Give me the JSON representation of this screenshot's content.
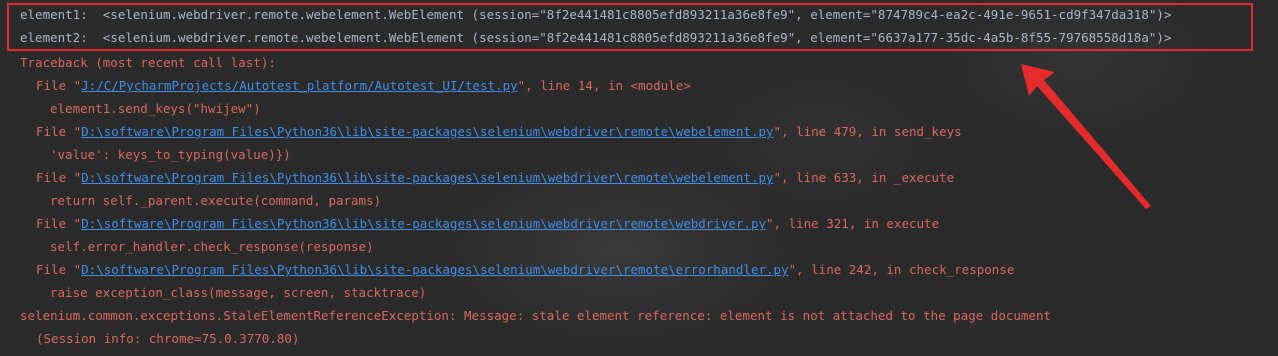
{
  "output": {
    "element1_line": "element1:  <selenium.webdriver.remote.webelement.WebElement (session=\"8f2e441481c8805efd893211a36e8fe9\", element=\"874789c4-ea2c-491e-9651-cd9f347da318\")>",
    "element2_line": "element2:  <selenium.webdriver.remote.webelement.WebElement (session=\"8f2e441481c8805efd893211a36e8fe9\", element=\"6637a177-35dc-4a5b-8f55-79768558d18a\")>",
    "traceback_header": "Traceback (most recent call last):",
    "frames": [
      {
        "prefix": "File \"",
        "path": "J:/C/PycharmProjects/Autotest_platform/Autotest_UI/test.py",
        "suffix": "\", line 14, in <module>",
        "code": "element1.send_keys(\"hwijew\")"
      },
      {
        "prefix": "File \"",
        "path": "D:\\software\\Program Files\\Python36\\lib\\site-packages\\selenium\\webdriver\\remote\\webelement.py",
        "suffix": "\", line 479, in send_keys",
        "code": "'value': keys_to_typing(value)})"
      },
      {
        "prefix": "File \"",
        "path": "D:\\software\\Program Files\\Python36\\lib\\site-packages\\selenium\\webdriver\\remote\\webelement.py",
        "suffix": "\", line 633, in _execute",
        "code": "return self._parent.execute(command, params)"
      },
      {
        "prefix": "File \"",
        "path": "D:\\software\\Program Files\\Python36\\lib\\site-packages\\selenium\\webdriver\\remote\\webdriver.py",
        "suffix": "\", line 321, in execute",
        "code": "self.error_handler.check_response(response)"
      },
      {
        "prefix": "File \"",
        "path": "D:\\software\\Program Files\\Python36\\lib\\site-packages\\selenium\\webdriver\\remote\\errorhandler.py",
        "suffix": "\", line 242, in check_response",
        "code": "raise exception_class(message, screen, stacktrace)"
      }
    ],
    "exception_line": "selenium.common.exceptions.StaleElementReferenceException: Message: stale element reference: element is not attached to the page document",
    "session_info": "(Session info: chrome=75.0.3770.80)"
  },
  "colors": {
    "background": "#2b2b2b",
    "plain_text": "#a9b7c6",
    "error_text": "#d9685f",
    "link": "#3f8ee8",
    "annotation": "#e52b2b"
  }
}
